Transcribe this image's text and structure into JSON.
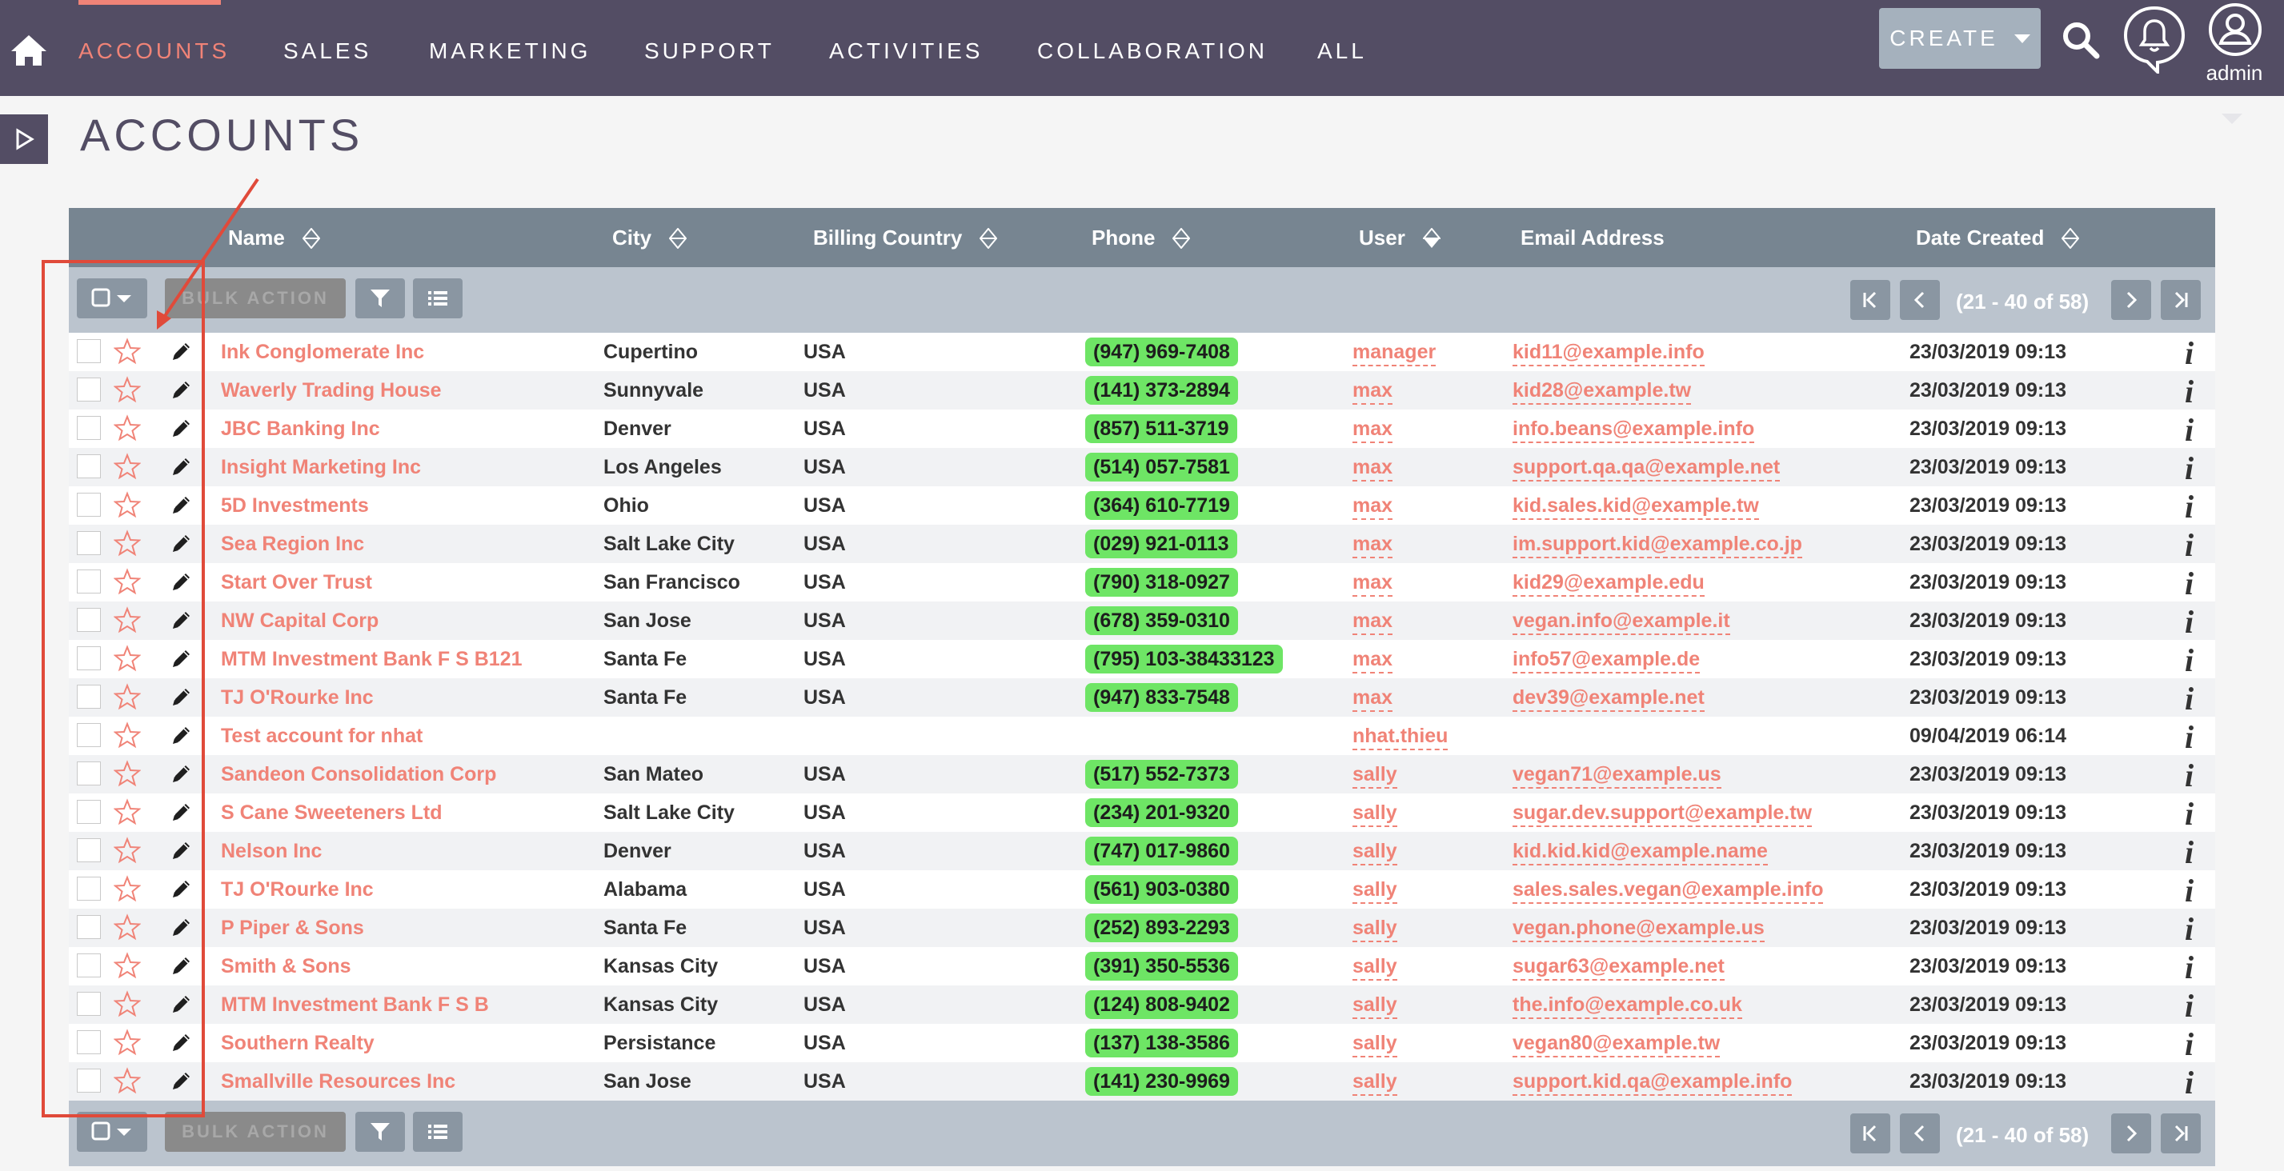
{
  "nav": {
    "tabs": [
      "ACCOUNTS",
      "SALES",
      "MARKETING",
      "SUPPORT",
      "ACTIVITIES",
      "COLLABORATION",
      "ALL"
    ],
    "active_index": 0,
    "create_label": "CREATE",
    "user_label": "admin"
  },
  "page_title": "ACCOUNTS",
  "table": {
    "columns": {
      "name": "Name",
      "city": "City",
      "country": "Billing Country",
      "phone": "Phone",
      "user": "User",
      "email": "Email Address",
      "date": "Date Created"
    },
    "bulk_action_label": "BULK ACTION",
    "pagination": "(21 - 40 of 58)",
    "rows": [
      {
        "name": "Ink Conglomerate Inc",
        "city": "Cupertino",
        "country": "USA",
        "phone": "(947) 969-7408",
        "user": "manager",
        "email": "kid11@example.info",
        "date": "23/03/2019 09:13"
      },
      {
        "name": "Waverly Trading House",
        "city": "Sunnyvale",
        "country": "USA",
        "phone": "(141) 373-2894",
        "user": "max",
        "email": "kid28@example.tw",
        "date": "23/03/2019 09:13"
      },
      {
        "name": "JBC Banking Inc",
        "city": "Denver",
        "country": "USA",
        "phone": "(857) 511-3719",
        "user": "max",
        "email": "info.beans@example.info",
        "date": "23/03/2019 09:13"
      },
      {
        "name": "Insight Marketing Inc",
        "city": "Los Angeles",
        "country": "USA",
        "phone": "(514) 057-7581",
        "user": "max",
        "email": "support.qa.qa@example.net",
        "date": "23/03/2019 09:13"
      },
      {
        "name": "5D Investments",
        "city": "Ohio",
        "country": "USA",
        "phone": "(364) 610-7719",
        "user": "max",
        "email": "kid.sales.kid@example.tw",
        "date": "23/03/2019 09:13"
      },
      {
        "name": "Sea Region Inc",
        "city": "Salt Lake City",
        "country": "USA",
        "phone": "(029) 921-0113",
        "user": "max",
        "email": "im.support.kid@example.co.jp",
        "date": "23/03/2019 09:13"
      },
      {
        "name": "Start Over Trust",
        "city": "San Francisco",
        "country": "USA",
        "phone": "(790) 318-0927",
        "user": "max",
        "email": "kid29@example.edu",
        "date": "23/03/2019 09:13"
      },
      {
        "name": "NW Capital Corp",
        "city": "San Jose",
        "country": "USA",
        "phone": "(678) 359-0310",
        "user": "max",
        "email": "vegan.info@example.it",
        "date": "23/03/2019 09:13"
      },
      {
        "name": "MTM Investment Bank F S B121",
        "city": "Santa Fe",
        "country": "USA",
        "phone": "(795) 103-38433123",
        "user": "max",
        "email": "info57@example.de",
        "date": "23/03/2019 09:13"
      },
      {
        "name": "TJ O'Rourke Inc",
        "city": "Santa Fe",
        "country": "USA",
        "phone": "(947) 833-7548",
        "user": "max",
        "email": "dev39@example.net",
        "date": "23/03/2019 09:13"
      },
      {
        "name": "Test account for nhat",
        "city": "",
        "country": "",
        "phone": "",
        "user": "nhat.thieu",
        "email": "",
        "date": "09/04/2019 06:14"
      },
      {
        "name": "Sandeon Consolidation Corp",
        "city": "San Mateo",
        "country": "USA",
        "phone": "(517) 552-7373",
        "user": "sally",
        "email": "vegan71@example.us",
        "date": "23/03/2019 09:13"
      },
      {
        "name": "S Cane Sweeteners Ltd",
        "city": "Salt Lake City",
        "country": "USA",
        "phone": "(234) 201-9320",
        "user": "sally",
        "email": "sugar.dev.support@example.tw",
        "date": "23/03/2019 09:13"
      },
      {
        "name": "Nelson Inc",
        "city": "Denver",
        "country": "USA",
        "phone": "(747) 017-9860",
        "user": "sally",
        "email": "kid.kid.kid@example.name",
        "date": "23/03/2019 09:13"
      },
      {
        "name": "TJ O'Rourke Inc",
        "city": "Alabama",
        "country": "USA",
        "phone": "(561) 903-0380",
        "user": "sally",
        "email": "sales.sales.vegan@example.info",
        "date": "23/03/2019 09:13"
      },
      {
        "name": "P Piper & Sons",
        "city": "Santa Fe",
        "country": "USA",
        "phone": "(252) 893-2293",
        "user": "sally",
        "email": "vegan.phone@example.us",
        "date": "23/03/2019 09:13"
      },
      {
        "name": "Smith & Sons",
        "city": "Kansas City",
        "country": "USA",
        "phone": "(391) 350-5536",
        "user": "sally",
        "email": "sugar63@example.net",
        "date": "23/03/2019 09:13"
      },
      {
        "name": "MTM Investment Bank F S B",
        "city": "Kansas City",
        "country": "USA",
        "phone": "(124) 808-9402",
        "user": "sally",
        "email": "the.info@example.co.uk",
        "date": "23/03/2019 09:13"
      },
      {
        "name": "Southern Realty",
        "city": "Persistance",
        "country": "USA",
        "phone": "(137) 138-3586",
        "user": "sally",
        "email": "vegan80@example.tw",
        "date": "23/03/2019 09:13"
      },
      {
        "name": "Smallville Resources Inc",
        "city": "San Jose",
        "country": "USA",
        "phone": "(141) 230-9969",
        "user": "sally",
        "email": "support.kid.qa@example.info",
        "date": "23/03/2019 09:13"
      }
    ]
  },
  "colors": {
    "nav_bg": "#534d64",
    "accent": "#f08377",
    "header_bg": "#778591",
    "toolbar_bg": "#bbc4ce",
    "phone_bg": "#6ee565",
    "annotation": "#e04a3a"
  }
}
